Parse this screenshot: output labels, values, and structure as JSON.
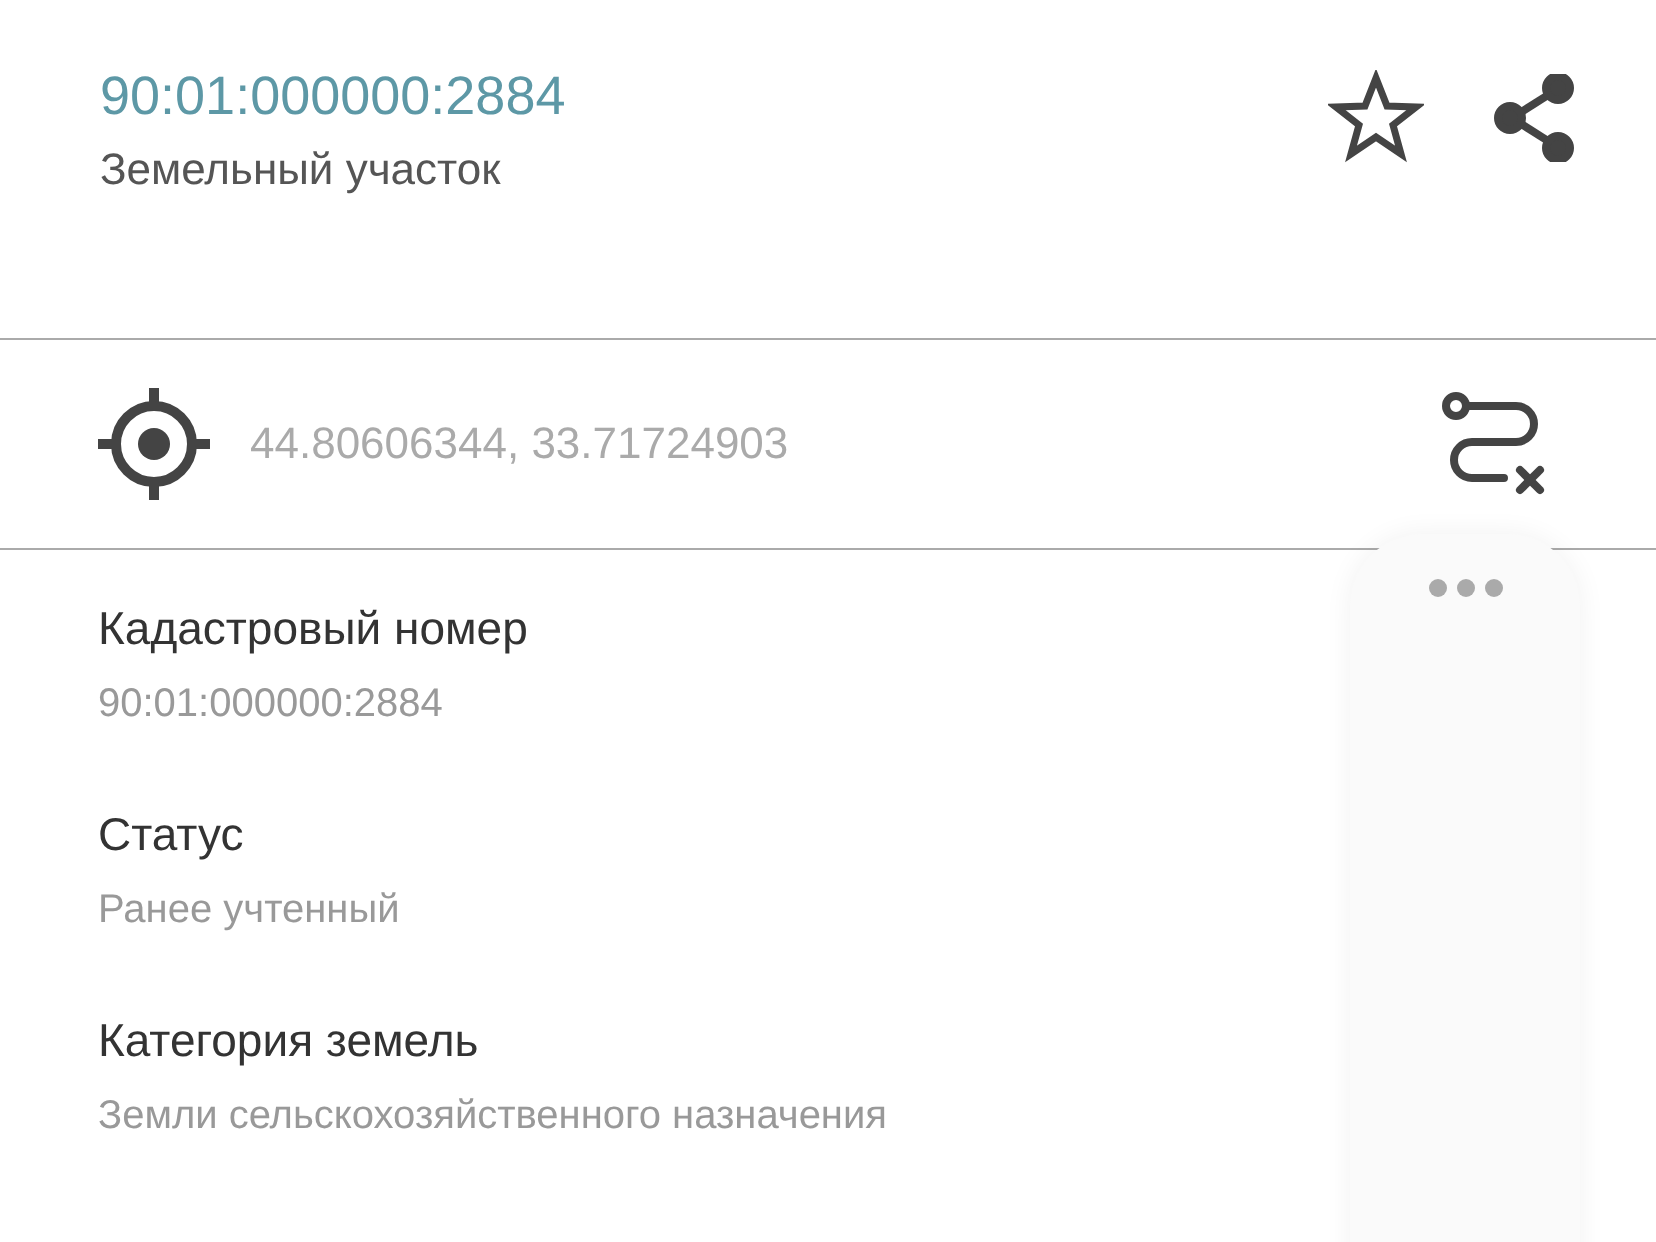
{
  "header": {
    "number": "90:01:000000:2884",
    "type": "Земельный участок"
  },
  "location": {
    "coordinates": "44.80606344, 33.71724903"
  },
  "fields": [
    {
      "label": "Кадастровый номер",
      "value": "90:01:000000:2884"
    },
    {
      "label": "Статус",
      "value": "Ранее учтенный"
    },
    {
      "label": "Категория земель",
      "value": "Земли сельскохозяйственного назначения"
    }
  ]
}
